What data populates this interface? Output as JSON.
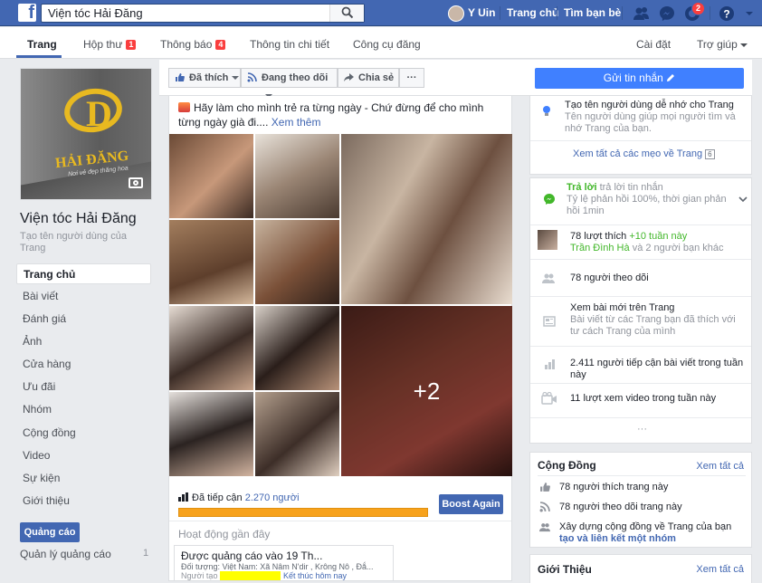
{
  "topbar": {
    "search_value": "Viện tóc Hải Đăng",
    "user_name": "Y Uin",
    "nav_home": "Trang chủ",
    "nav_find_friends": "Tìm bạn bè",
    "notif_count": "2",
    "icons": [
      "facebook-logo",
      "search-icon",
      "friend-requests-icon",
      "messenger-icon",
      "notifications-icon",
      "help-icon",
      "dropdown-icon"
    ]
  },
  "pagenav": {
    "tabs": [
      {
        "label": "Trang"
      },
      {
        "label": "Hộp thư",
        "count": "1"
      },
      {
        "label": "Thông báo",
        "count": "4"
      },
      {
        "label": "Thông tin chi tiết"
      },
      {
        "label": "Công cụ đăng"
      }
    ],
    "settings": "Cài đặt",
    "help": "Trợ giúp"
  },
  "left": {
    "cover_brand": "HẢI ĐĂNG",
    "cover_slogan": "Nơi vẻ đẹp thăng hoa",
    "page_name": "Viện tóc Hải Đăng",
    "create_username": "Tạo tên người dùng của Trang",
    "nav": [
      "Trang chủ",
      "Bài viết",
      "Đánh giá",
      "Ảnh",
      "Cửa hàng",
      "Ưu đãi",
      "Nhóm",
      "Cộng đồng",
      "Video",
      "Sự kiện",
      "Giới thiệu"
    ],
    "ads_button": "Quảng cáo",
    "ads_manage": "Quản lý quảng cáo",
    "ads_count": "1"
  },
  "actionbar": {
    "liked": "Đã thích",
    "following": "Đang theo dõi",
    "share": "Chia sẻ",
    "more": "···",
    "send_message": "Gửi tin nhắn"
  },
  "post": {
    "text": "Hãy làm cho mình trẻ ra từng ngày - Chứ đừng để cho mình từng ngày già đi....",
    "see_more": "Xem thêm",
    "more_photos": "+2",
    "reach_label": "Đã tiếp cận",
    "reach_value": "2.270 người",
    "reach_fraction": 1.0,
    "boost": "Boost Again",
    "activity_title": "Hoạt động gần đây",
    "act_title": "Được quảng cáo vào 19 Th...",
    "act_target": "Đối tượng: Việt Nam: Xã Nâm N'dir , Krông Nô , Đắ...",
    "act_people": "Người tạo",
    "act_end": "Kết thúc hôm nay"
  },
  "right": {
    "tip_title": "Tạo tên người dùng dễ nhớ cho Trang",
    "tip_sub": "Tên người dùng giúp mọi người tìm và nhớ Trang của bạn.",
    "tips_link": "Xem tất cả các mẹo về Trang",
    "tips_count": "6",
    "resp_label": "Trả lời",
    "resp_link": "trả lời tin nhắn",
    "resp_rate": "Tỷ lệ phản hồi 100%, thời gian phản hồi 1min",
    "likes_text": "78 lượt thích",
    "likes_week": "+10 tuần này",
    "likes_by_name": "Trần Đình Hà",
    "likes_by_rest": "và 2 người bạn khác",
    "followers": "78 người theo dõi",
    "posts_title": "Xem bài mới trên Trang",
    "posts_sub": "Bài viết từ các Trang bạn đã thích với tư cách Trang của mình",
    "reach": "2.411 người tiếp cận bài viết trong tuần này",
    "video": "11 lượt xem video trong tuần này",
    "more_dots": "···",
    "community_title": "Cộng Đồng",
    "community_seeall": "Xem tất cả",
    "community_likes": "78 người thích trang này",
    "community_follow": "78 người theo dõi trang này",
    "community_build": "Xây dựng cộng đồng về Trang của bạn",
    "community_link": "tạo và liên kết một nhóm",
    "about_title": "Giới Thiệu",
    "about_seeall": "Xem tất cả"
  },
  "colors": {
    "fb_blue": "#4267b2",
    "accent_blue": "#4080ff",
    "reach_orange": "#f7a21c",
    "badge_red": "#fa3e3e",
    "green": "#42b72a"
  }
}
